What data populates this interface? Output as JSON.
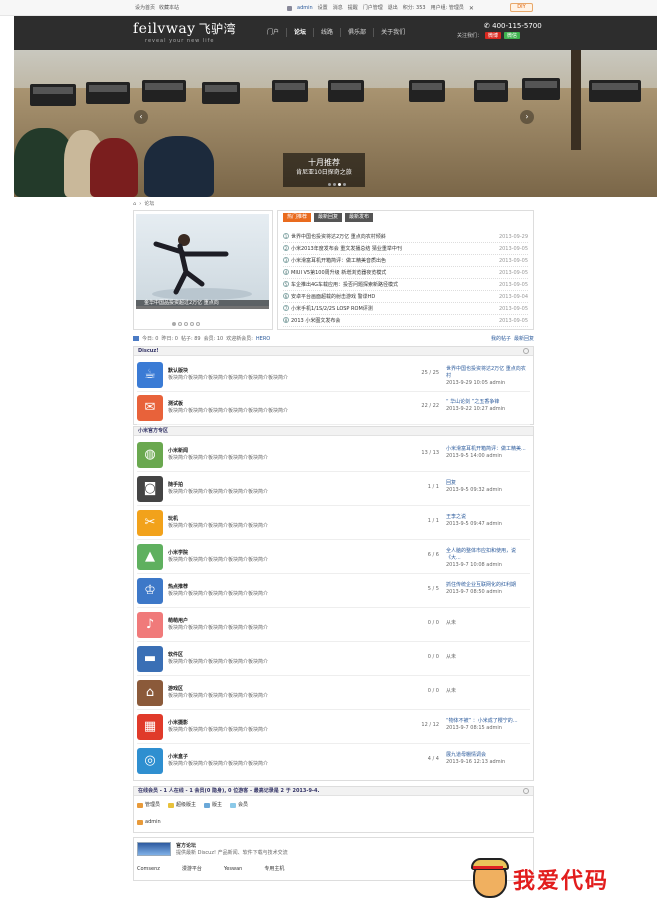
{
  "topbar": {
    "left": [
      "设为首页",
      "收藏本站"
    ],
    "user": "admin",
    "links": [
      "设置",
      "消息",
      "提醒",
      "门户管理",
      "退出"
    ],
    "credits": "积分: 353",
    "usergroup": "用户组: 管理员",
    "diy": "DIY"
  },
  "header": {
    "logo": "feilvway",
    "logo_cn": "飞驴湾",
    "tagline": "reveal your new life",
    "nav": [
      "门户",
      "论坛",
      "线路",
      "俱乐部",
      "关于我们"
    ],
    "active_nav": "论坛",
    "phone": "400-115-5700",
    "follow": "关注我们：",
    "weibo": "微博",
    "weixin": "微信"
  },
  "banner": {
    "caption_title": "十月推荐",
    "caption_sub": "肯尼亚10日探奇之旅",
    "prev": "‹",
    "next": "›"
  },
  "breadcrumb": {
    "home": "⌂",
    "sep": "›",
    "current": "论坛"
  },
  "slideshow": {
    "caption": "金华中国品投资超过2万亿 重点向"
  },
  "tabs": [
    "热门推荐",
    "最新回复",
    "最新发布"
  ],
  "news": [
    {
      "n": "1",
      "t": "世界中国也投资将达2万亿 重点向农村倾斜",
      "d": "2013-09-29"
    },
    {
      "n": "2",
      "t": "小米2013年度发布会 重文发播总结 猜业重举中刊",
      "d": "2013-09-05"
    },
    {
      "n": "3",
      "t": "小米滑富耳机开箱简评：做工精美音质出色",
      "d": "2013-09-05"
    },
    {
      "n": "4",
      "t": "MIUI V5第100周升级 新增浏览器夜览模式",
      "d": "2013-09-05"
    },
    {
      "n": "5",
      "t": "车企推出4G车载应用：投否问题探索新路径模式",
      "d": "2013-09-05"
    },
    {
      "n": "6",
      "t": "安卓平台画面超载的射击游戏 警谍HD",
      "d": "2013-09-04"
    },
    {
      "n": "7",
      "t": "小米手机1/1S/2/2S LOSP ROM评测",
      "d": "2013-09-05"
    },
    {
      "n": "8",
      "t": "2013 小米图文发布会",
      "d": "2013-09-05"
    }
  ],
  "stats": {
    "items": [
      "今日: 0",
      "昨日: 0",
      "帖子: 89",
      "会员: 10"
    ],
    "newest_label": "欢迎新会员:",
    "newest": "HERO",
    "right": [
      "我的帖子",
      "最新回复"
    ]
  },
  "sections": [
    {
      "title": "Discuz!",
      "forums": [
        {
          "name": "默认版块",
          "desc": "板块简介板块简介板块简介板块简介板块简介板块简介",
          "count": "25 / 25",
          "last": "世界中国也投资将达2万亿 重点向农村",
          "meta": "2013-9-29 10:05 admin",
          "color": "#3a7bd5",
          "icon": "cup-icon",
          "glyph": "☕"
        },
        {
          "name": "测试板",
          "desc": "板块简介板块简介板块简介板块简介板块简介板块简介",
          "count": "22 / 22",
          "last": "“ 华山论剑 ”之五香争锋",
          "meta": "2013-9-22 10:27 admin",
          "color": "#e8623a",
          "icon": "chat-icon",
          "glyph": "✉"
        }
      ]
    },
    {
      "title": "小米官方专区",
      "forums": [
        {
          "name": "小米新闻",
          "desc": "板块简介板块简介板块简介板块简介板块简介",
          "count": "13 / 13",
          "last": "小米滑富耳机开箱简评：做工精美...",
          "meta": "2013-9-5 14:00 admin",
          "color": "#6aa84f",
          "icon": "globe-icon",
          "glyph": "◍"
        },
        {
          "name": "随手拍",
          "desc": "板块简介板块简介板块简介板块简介板块简介",
          "count": "1 / 1",
          "last": "回复",
          "meta": "2013-9-5 09:32 admin",
          "color": "#444444",
          "icon": "camera-icon",
          "glyph": "◙"
        },
        {
          "name": "玩机",
          "desc": "板块简介板块简介板块简介板块简介板块简介",
          "count": "1 / 1",
          "last": "王李之说",
          "meta": "2013-9-5 09:47 admin",
          "color": "#f2a21b",
          "icon": "tools-icon",
          "glyph": "✂"
        },
        {
          "name": "小米学院",
          "desc": "板块简介板块简介板块简介板块简介板块简介",
          "count": "6 / 6",
          "last": "全人脑的整体市应扣和使用，说《大...",
          "meta": "2013-9-7 10:08 admin",
          "color": "#5fb05f",
          "icon": "picture-icon",
          "glyph": "▲"
        },
        {
          "name": "热点推荐",
          "desc": "板块简介板块简介板块简介板块简介板块简介",
          "count": "5 / 5",
          "last": "抓住传统企业互联网化的红利期",
          "meta": "2013-9-7 08:50 admin",
          "color": "#3d78c8",
          "icon": "graduation-icon",
          "glyph": "♔"
        },
        {
          "name": "萌萌用户",
          "desc": "板块简介板块简介板块简介板块简介板块简介",
          "count": "0 / 0",
          "last": "从未",
          "meta": "",
          "color": "#f07a7a",
          "icon": "guitar-icon",
          "glyph": "♪"
        },
        {
          "name": "软件区",
          "desc": "板块简介板块简介板块简介板块简介板块简介",
          "count": "0 / 0",
          "last": "从未",
          "meta": "",
          "color": "#3a6fb5",
          "icon": "car-icon",
          "glyph": "▬"
        },
        {
          "name": "游戏区",
          "desc": "板块简介板块简介板块简介板块简介板块简介",
          "count": "0 / 0",
          "last": "从未",
          "meta": "",
          "color": "#8b5a3a",
          "icon": "house-icon",
          "glyph": "⌂"
        },
        {
          "name": "小米摄影",
          "desc": "板块简介板块简介板块简介板块简介板块简介",
          "count": "12 / 12",
          "last": "“物体不被” ：小米成了樱宁的...",
          "meta": "2013-9-7 08:15 admin",
          "color": "#e03a2a",
          "icon": "building-icon",
          "glyph": "▦"
        },
        {
          "name": "小米盒子",
          "desc": "板块简介板块简介板块简介板块简介板块简介",
          "count": "4 / 4",
          "last": "展九道母棚情调会",
          "meta": "2013-9-16 12:13 admin",
          "color": "#2f8fd0",
          "icon": "film-icon",
          "glyph": "◎"
        }
      ]
    }
  ],
  "online": {
    "title": "在线会员 - 1 人在线 - 1 会员(0 隐身), 0 位游客 - 最高记录是 2 于 2013-9-4.",
    "groups": [
      "管理员",
      "超级版主",
      "版主",
      "会员"
    ],
    "group_colors": [
      "#e89a3a",
      "#e8c13a",
      "#6aa8d8",
      "#8bc9e8"
    ],
    "user": "admin"
  },
  "footer": {
    "title": "官方论坛",
    "desc": "提供最新 Discuz! 产品新闻、软件下载与技术交流",
    "links": [
      "Comsenz",
      "漫游平台",
      "Yeswan",
      "专用主机"
    ]
  },
  "brand": {
    "text": "我爱代码"
  }
}
